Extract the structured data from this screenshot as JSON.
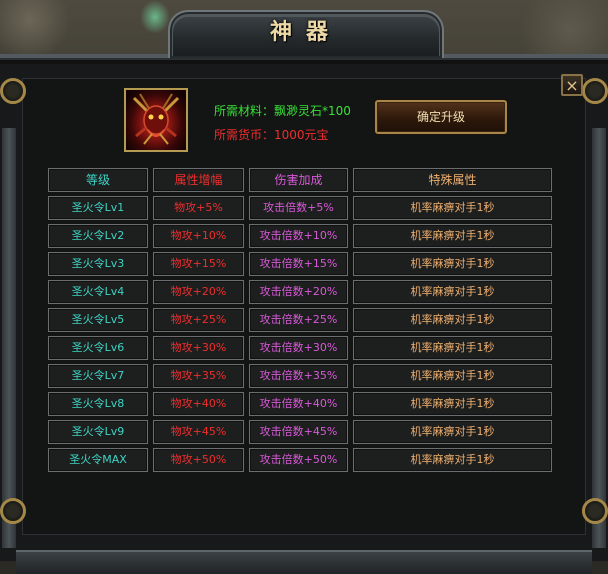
{
  "window": {
    "title": "神器",
    "close_label": "×"
  },
  "item": {
    "icon_name": "demon-artifact-icon"
  },
  "requirements": {
    "material": "所需材料：飘渺灵石*100",
    "currency": "所需货币：1000元宝"
  },
  "actions": {
    "upgrade_label": "确定升级"
  },
  "table": {
    "headers": [
      "等级",
      "属性增幅",
      "伤害加成",
      "特殊属性"
    ],
    "rows": [
      [
        "圣火令Lv1",
        "物攻+5%",
        "攻击倍数+5%",
        "机率麻痹对手1秒"
      ],
      [
        "圣火令Lv2",
        "物攻+10%",
        "攻击倍数+10%",
        "机率麻痹对手1秒"
      ],
      [
        "圣火令Lv3",
        "物攻+15%",
        "攻击倍数+15%",
        "机率麻痹对手1秒"
      ],
      [
        "圣火令Lv4",
        "物攻+20%",
        "攻击倍数+20%",
        "机率麻痹对手1秒"
      ],
      [
        "圣火令Lv5",
        "物攻+25%",
        "攻击倍数+25%",
        "机率麻痹对手1秒"
      ],
      [
        "圣火令Lv6",
        "物攻+30%",
        "攻击倍数+30%",
        "机率麻痹对手1秒"
      ],
      [
        "圣火令Lv7",
        "物攻+35%",
        "攻击倍数+35%",
        "机率麻痹对手1秒"
      ],
      [
        "圣火令Lv8",
        "物攻+40%",
        "攻击倍数+40%",
        "机率麻痹对手1秒"
      ],
      [
        "圣火令Lv9",
        "物攻+45%",
        "攻击倍数+45%",
        "机率麻痹对手1秒"
      ],
      [
        "圣火令MAX",
        "物攻+50%",
        "攻击倍数+50%",
        "机率麻痹对手1秒"
      ]
    ]
  },
  "colors": {
    "level": "#3ed4c4",
    "attribute": "#ee2e2e",
    "damage": "#d85ad8",
    "special": "#f0b070",
    "material": "#38e038",
    "currency": "#ee2e2e",
    "title": "#ecd9a6"
  }
}
